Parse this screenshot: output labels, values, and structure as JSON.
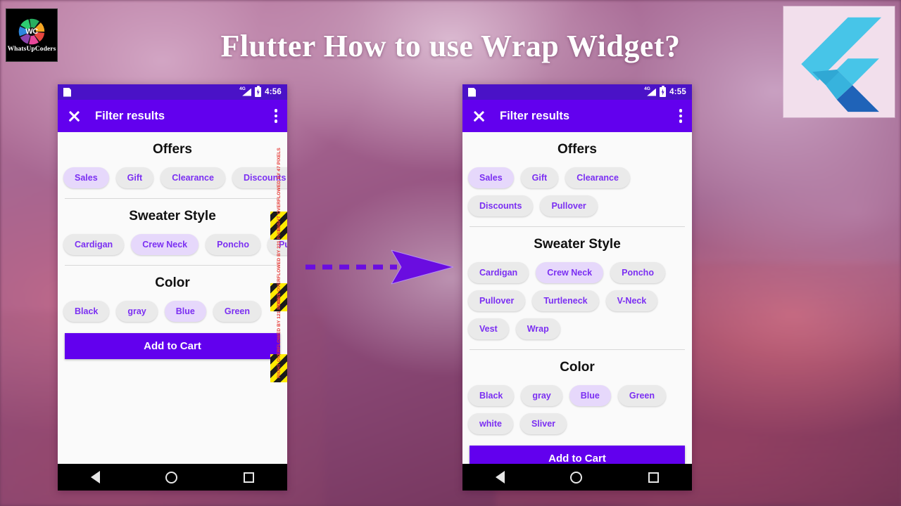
{
  "branding": {
    "logo_text": "WhatsUpCoders",
    "logo_monogram": "WC",
    "flutter_logo_name": "flutter-logo"
  },
  "page_title": "Flutter How to use Wrap Widget?",
  "colors": {
    "app_bar": "#6200EE",
    "status_bar": "#4A12C7",
    "chip_selected": "#E6D8FB",
    "chip_default": "#EAEAEA",
    "chip_text": "#7B2FF2",
    "overflow_warning": "#E53935",
    "arrow": "#6A0DE0"
  },
  "phone_left": {
    "name": "row-overflow-example",
    "status_bar": {
      "time": "4:56",
      "network": "4G"
    },
    "app_bar": {
      "title": "Filter results",
      "close_label": "Close",
      "menu_label": "More options"
    },
    "sections": [
      {
        "title": "Offers",
        "chips": [
          {
            "label": "Sales",
            "selected": true
          },
          {
            "label": "Gift",
            "selected": false
          },
          {
            "label": "Clearance",
            "selected": false
          },
          {
            "label": "Discounts",
            "selected": false
          }
        ],
        "overflow": "RIGHT OVERFLOWED BY 47 PIXELS"
      },
      {
        "title": "Sweater Style",
        "chips": [
          {
            "label": "Cardigan",
            "selected": false
          },
          {
            "label": "Crew Neck",
            "selected": true
          },
          {
            "label": "Poncho",
            "selected": false
          },
          {
            "label": "Pullover",
            "selected": false
          }
        ],
        "overflow": "RIGHT OVERFLOWED BY 221 PIXELS"
      },
      {
        "title": "Color",
        "chips": [
          {
            "label": "Black",
            "selected": false
          },
          {
            "label": "gray",
            "selected": false
          },
          {
            "label": "Blue",
            "selected": true
          },
          {
            "label": "Green",
            "selected": false
          }
        ],
        "overflow": "RIGHT OVERFLOWED BY 121 PIXELS"
      }
    ],
    "cart_button": "Add to Cart",
    "nav_bar": {
      "back": "back",
      "home": "home",
      "recents": "recents"
    }
  },
  "phone_right": {
    "name": "wrap-widget-example",
    "status_bar": {
      "time": "4:55",
      "network": "4G"
    },
    "app_bar": {
      "title": "Filter results",
      "close_label": "Close",
      "menu_label": "More options"
    },
    "sections": [
      {
        "title": "Offers",
        "chips": [
          {
            "label": "Sales",
            "selected": true
          },
          {
            "label": "Gift",
            "selected": false
          },
          {
            "label": "Clearance",
            "selected": false
          },
          {
            "label": "Discounts",
            "selected": false
          },
          {
            "label": "Pullover",
            "selected": false
          }
        ]
      },
      {
        "title": "Sweater Style",
        "chips": [
          {
            "label": "Cardigan",
            "selected": false
          },
          {
            "label": "Crew Neck",
            "selected": true
          },
          {
            "label": "Poncho",
            "selected": false
          },
          {
            "label": "Pullover",
            "selected": false
          },
          {
            "label": "Turtleneck",
            "selected": false
          },
          {
            "label": "V-Neck",
            "selected": false
          },
          {
            "label": "Vest",
            "selected": false
          },
          {
            "label": "Wrap",
            "selected": false
          }
        ]
      },
      {
        "title": "Color",
        "chips": [
          {
            "label": "Black",
            "selected": false
          },
          {
            "label": "gray",
            "selected": false
          },
          {
            "label": "Blue",
            "selected": true
          },
          {
            "label": "Green",
            "selected": false
          },
          {
            "label": "white",
            "selected": false
          },
          {
            "label": "Sliver",
            "selected": false
          }
        ]
      }
    ],
    "cart_button": "Add to Cart",
    "nav_bar": {
      "back": "back",
      "home": "home",
      "recents": "recents"
    }
  }
}
